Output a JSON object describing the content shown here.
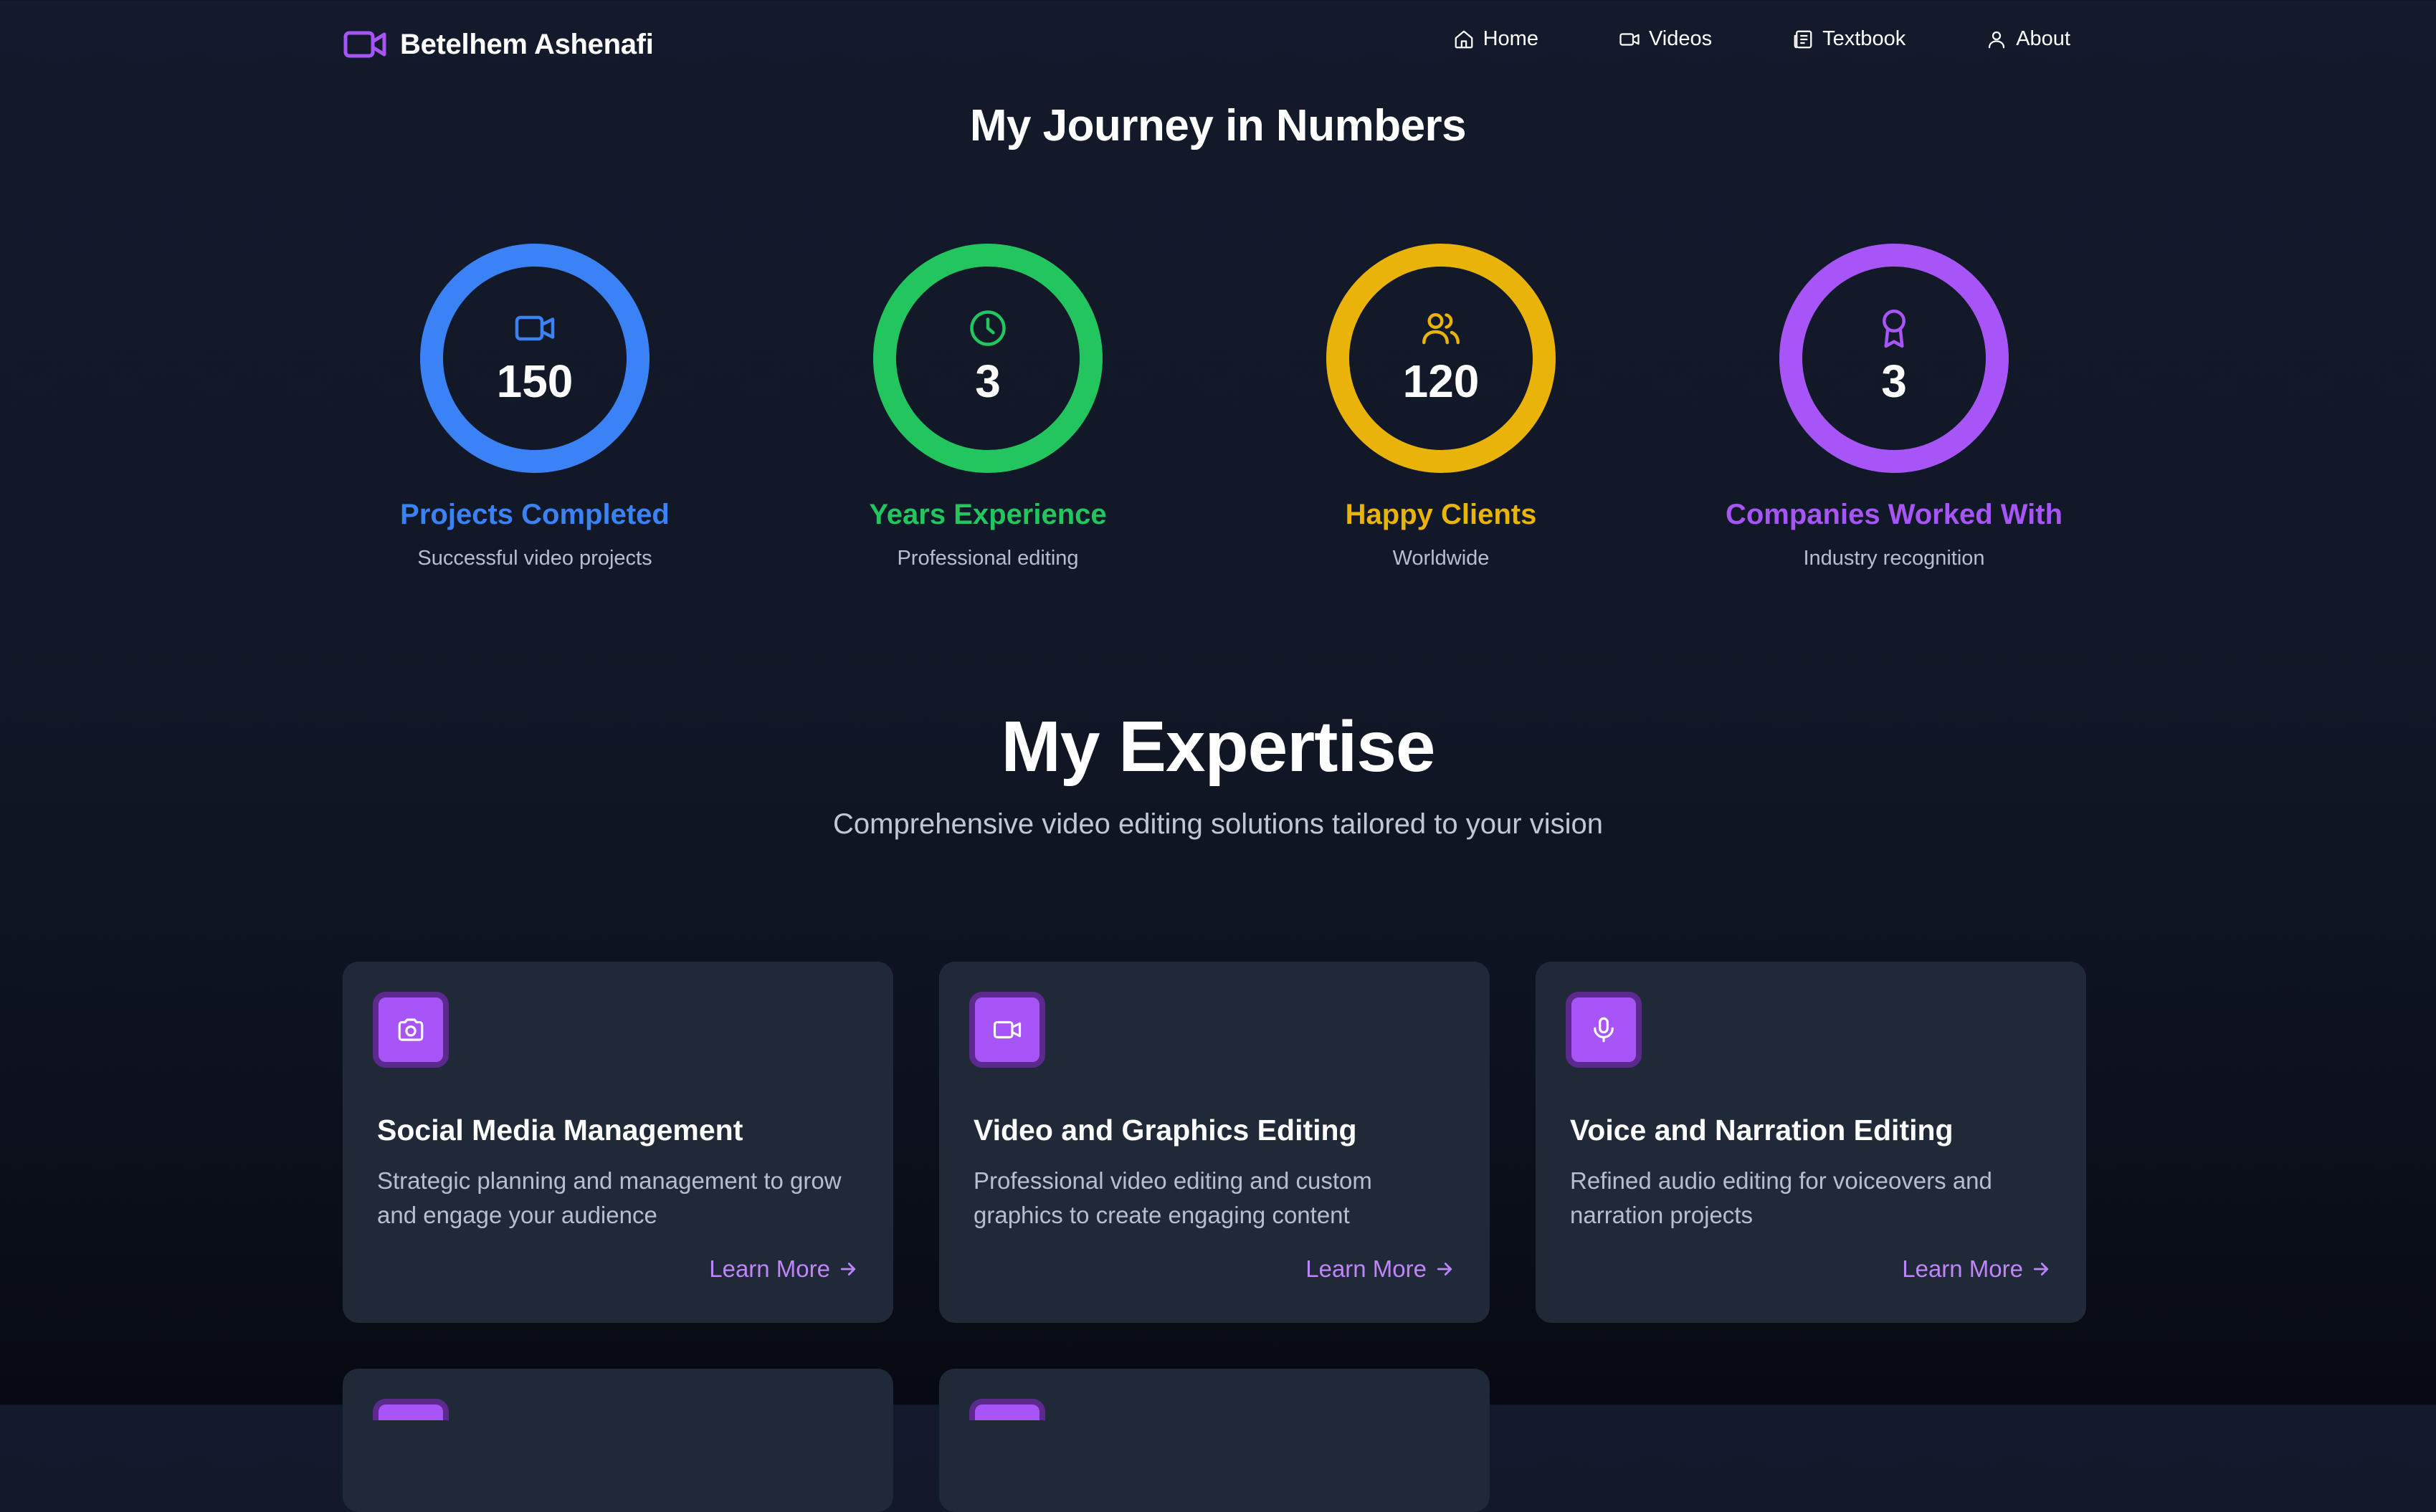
{
  "brand": {
    "name": "Betelhem Ashenafi",
    "icon": "video-icon",
    "accent": "#a855f7"
  },
  "nav": {
    "items": [
      {
        "label": "Home",
        "icon": "home-icon"
      },
      {
        "label": "Videos",
        "icon": "video-icon"
      },
      {
        "label": "Textbook",
        "icon": "newspaper-icon"
      },
      {
        "label": "About",
        "icon": "user-icon"
      }
    ]
  },
  "journey": {
    "title": "My Journey in Numbers",
    "stats": [
      {
        "value": "150",
        "label": "Projects Completed",
        "sub": "Successful video projects",
        "color": "#3b82f6",
        "icon": "video-icon"
      },
      {
        "value": "3",
        "label": "Years Experience",
        "sub": "Professional editing",
        "color": "#22c55e",
        "icon": "clock-icon"
      },
      {
        "value": "120",
        "label": "Happy Clients",
        "sub": "Worldwide",
        "color": "#eab308",
        "icon": "users-icon"
      },
      {
        "value": "3",
        "label": "Companies Worked With",
        "sub": "Industry recognition",
        "color": "#a855f7",
        "icon": "award-icon"
      }
    ]
  },
  "expertise": {
    "title": "My Expertise",
    "subtitle": "Comprehensive video editing solutions tailored to your vision",
    "cards": [
      {
        "title": "Social Media Management",
        "desc": "Strategic planning and management to grow and engage your audience",
        "link": "Learn More",
        "icon": "camera-icon"
      },
      {
        "title": "Video and Graphics Editing",
        "desc": "Professional video editing and custom graphics to create engaging content",
        "link": "Learn More",
        "icon": "video-icon"
      },
      {
        "title": "Voice and Narration Editing",
        "desc": "Refined audio editing for voiceovers and narration projects",
        "link": "Learn More",
        "icon": "mic-icon"
      }
    ]
  }
}
